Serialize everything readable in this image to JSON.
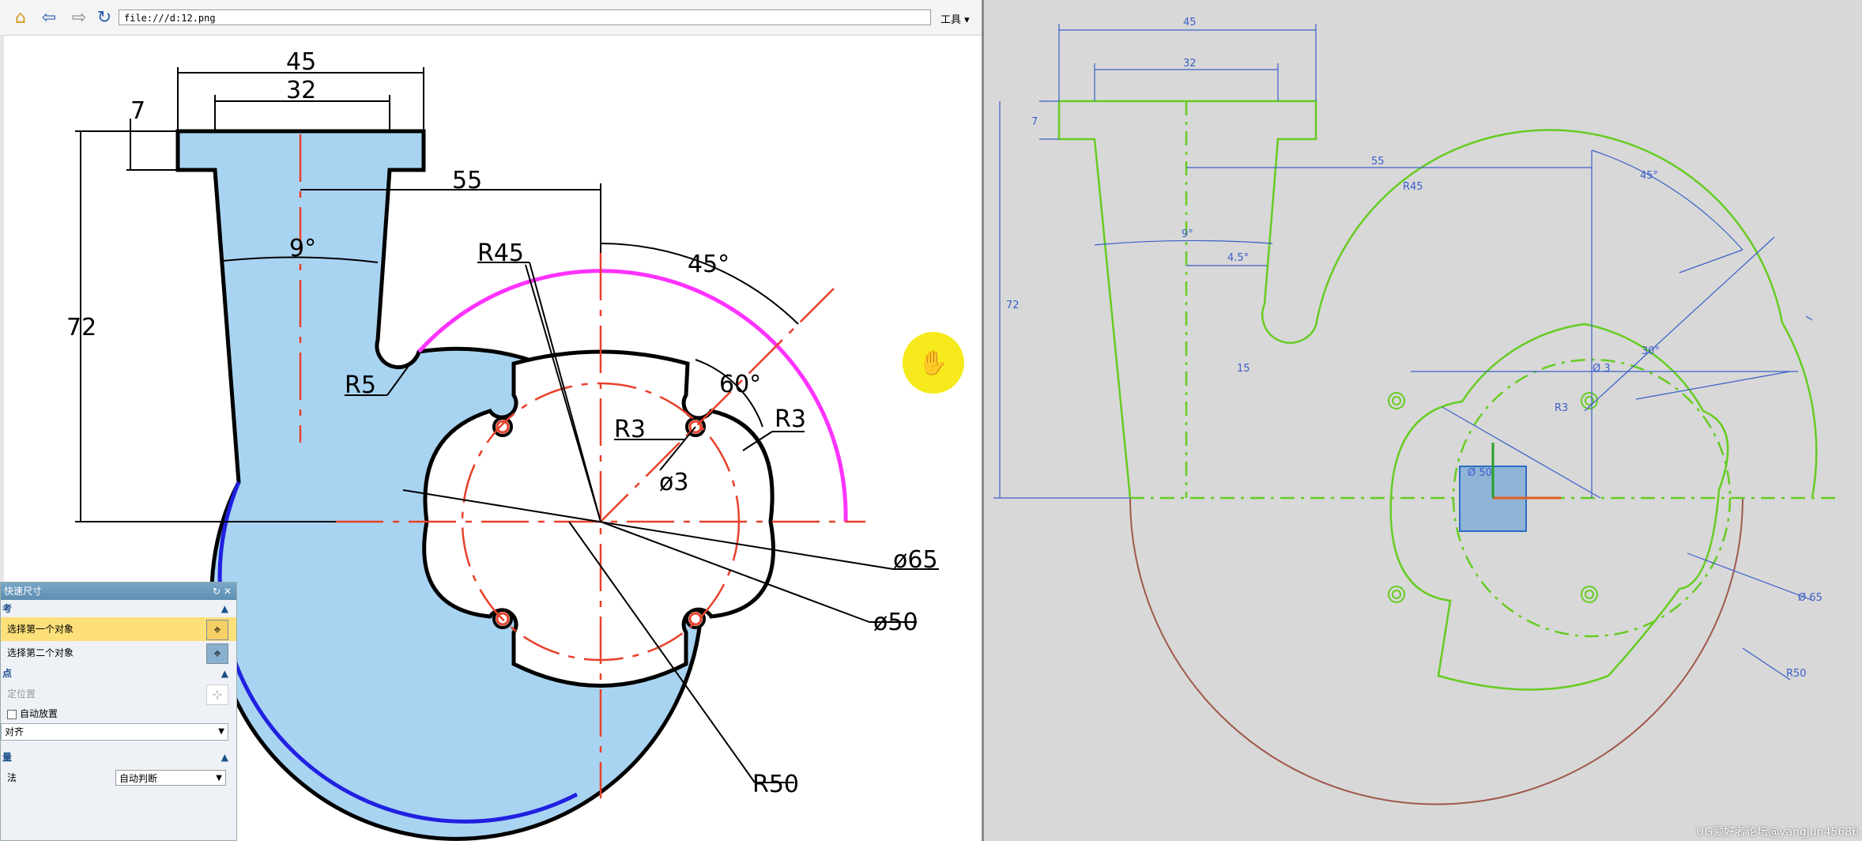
{
  "browser": {
    "address": "file:///d:12.png",
    "tools_label": "工具 ▾",
    "icons": [
      "home-icon",
      "back-arrow-icon",
      "forward-arrow-icon",
      "refresh-icon"
    ]
  },
  "drawing": {
    "dims": {
      "d45": "45",
      "d32": "32",
      "d7": "7",
      "d55": "55",
      "d9": "9°",
      "d72": "72",
      "r45": "R45",
      "a45": "45°",
      "a60": "60°",
      "r3a": "R3",
      "r3b": "R3",
      "phi3": "ø3",
      "phi65": "ø65",
      "phi50": "ø50",
      "r50": "R50",
      "r5": "R5"
    },
    "colors": {
      "fill": "#a8d4f2",
      "arc_magenta": "#ff33ff",
      "arc_blue": "#2020e0",
      "center": "#e8402a"
    }
  },
  "dialog": {
    "title": "快速尺寸",
    "sec1": "考",
    "sel1": "选择第一个对象",
    "sel2": "选择第二个对象",
    "sec2": "点",
    "place": "定位置",
    "auto_place": "自动放置",
    "align": "对齐",
    "sec3": "量",
    "method_label": "法",
    "method_value": "自动判断"
  },
  "cad": {
    "dims": {
      "d45": "45",
      "d32": "32",
      "d7": "7",
      "d72": "72",
      "d55": "55",
      "d9": "9°",
      "d45b": "4.5°",
      "r15": "15",
      "r45": "R45",
      "a45": "45°",
      "phi65": "Ø 65",
      "r50": "R50",
      "a30": "30°",
      "phi3": "Ø 3",
      "r3": "R3",
      "phi50": "Ø 50"
    },
    "colors": {
      "sketch": "#66cc22",
      "dim": "#3a5fc8",
      "arc_brown": "#a0584c"
    }
  },
  "watermark": "UG爱好者论坛@yangjun45686"
}
